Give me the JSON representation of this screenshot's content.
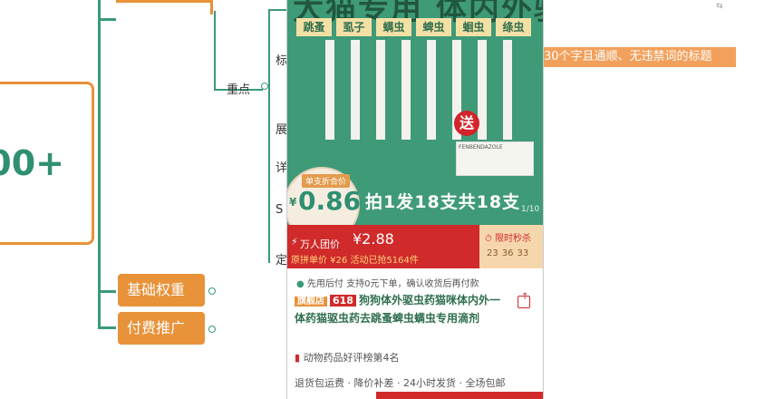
{
  "mindmap": {
    "root_text": "00+",
    "branch_focus": "重点",
    "branch_basic": "基础权重",
    "branch_paid": "付费推广",
    "side_labels": [
      "标",
      "展",
      "详",
      "S",
      "定"
    ],
    "note": "30个字且通顺、无违禁词的标题"
  },
  "phone": {
    "hero": {
      "title": "大猫专用 体内外驱虫",
      "tags": [
        "跳蚤",
        "虱子",
        "螨虫",
        "蜱虫",
        "蛔虫",
        "绦虫"
      ],
      "gift_badge": "送",
      "product_box_text": "FENBENDAZOLE",
      "price_label": "单支折合价",
      "price_currency": "¥",
      "price_value": "0.86",
      "slogan": "拍1发18支共18支",
      "counter": "1/10"
    },
    "price_bar": {
      "label": "万人团价",
      "price": "¥2.88",
      "original": "原拼单价 ¥26  活动已抢5164件"
    },
    "countdown": {
      "label": "限时秒杀",
      "digits": [
        "23",
        "36",
        "33"
      ]
    },
    "info_row": "先用后付  支持0元下单，确认收货后再付款",
    "product": {
      "store_flag": "旗舰店",
      "flag_618": "618",
      "title": "狗狗体外驱虫药猫咪体内外一体药猫驱虫药去跳蚤蜱虫螨虫专用滴剂"
    },
    "rank": "动物药品好评榜第4名",
    "services": "退货包运费 · 降价补差 · 24小时发货 · 全场包邮"
  },
  "colors": {
    "mind_green": "#3a9a7a",
    "mind_orange": "#e8923a",
    "hero_green": "#3f9a78",
    "price_red": "#d02a2a"
  }
}
